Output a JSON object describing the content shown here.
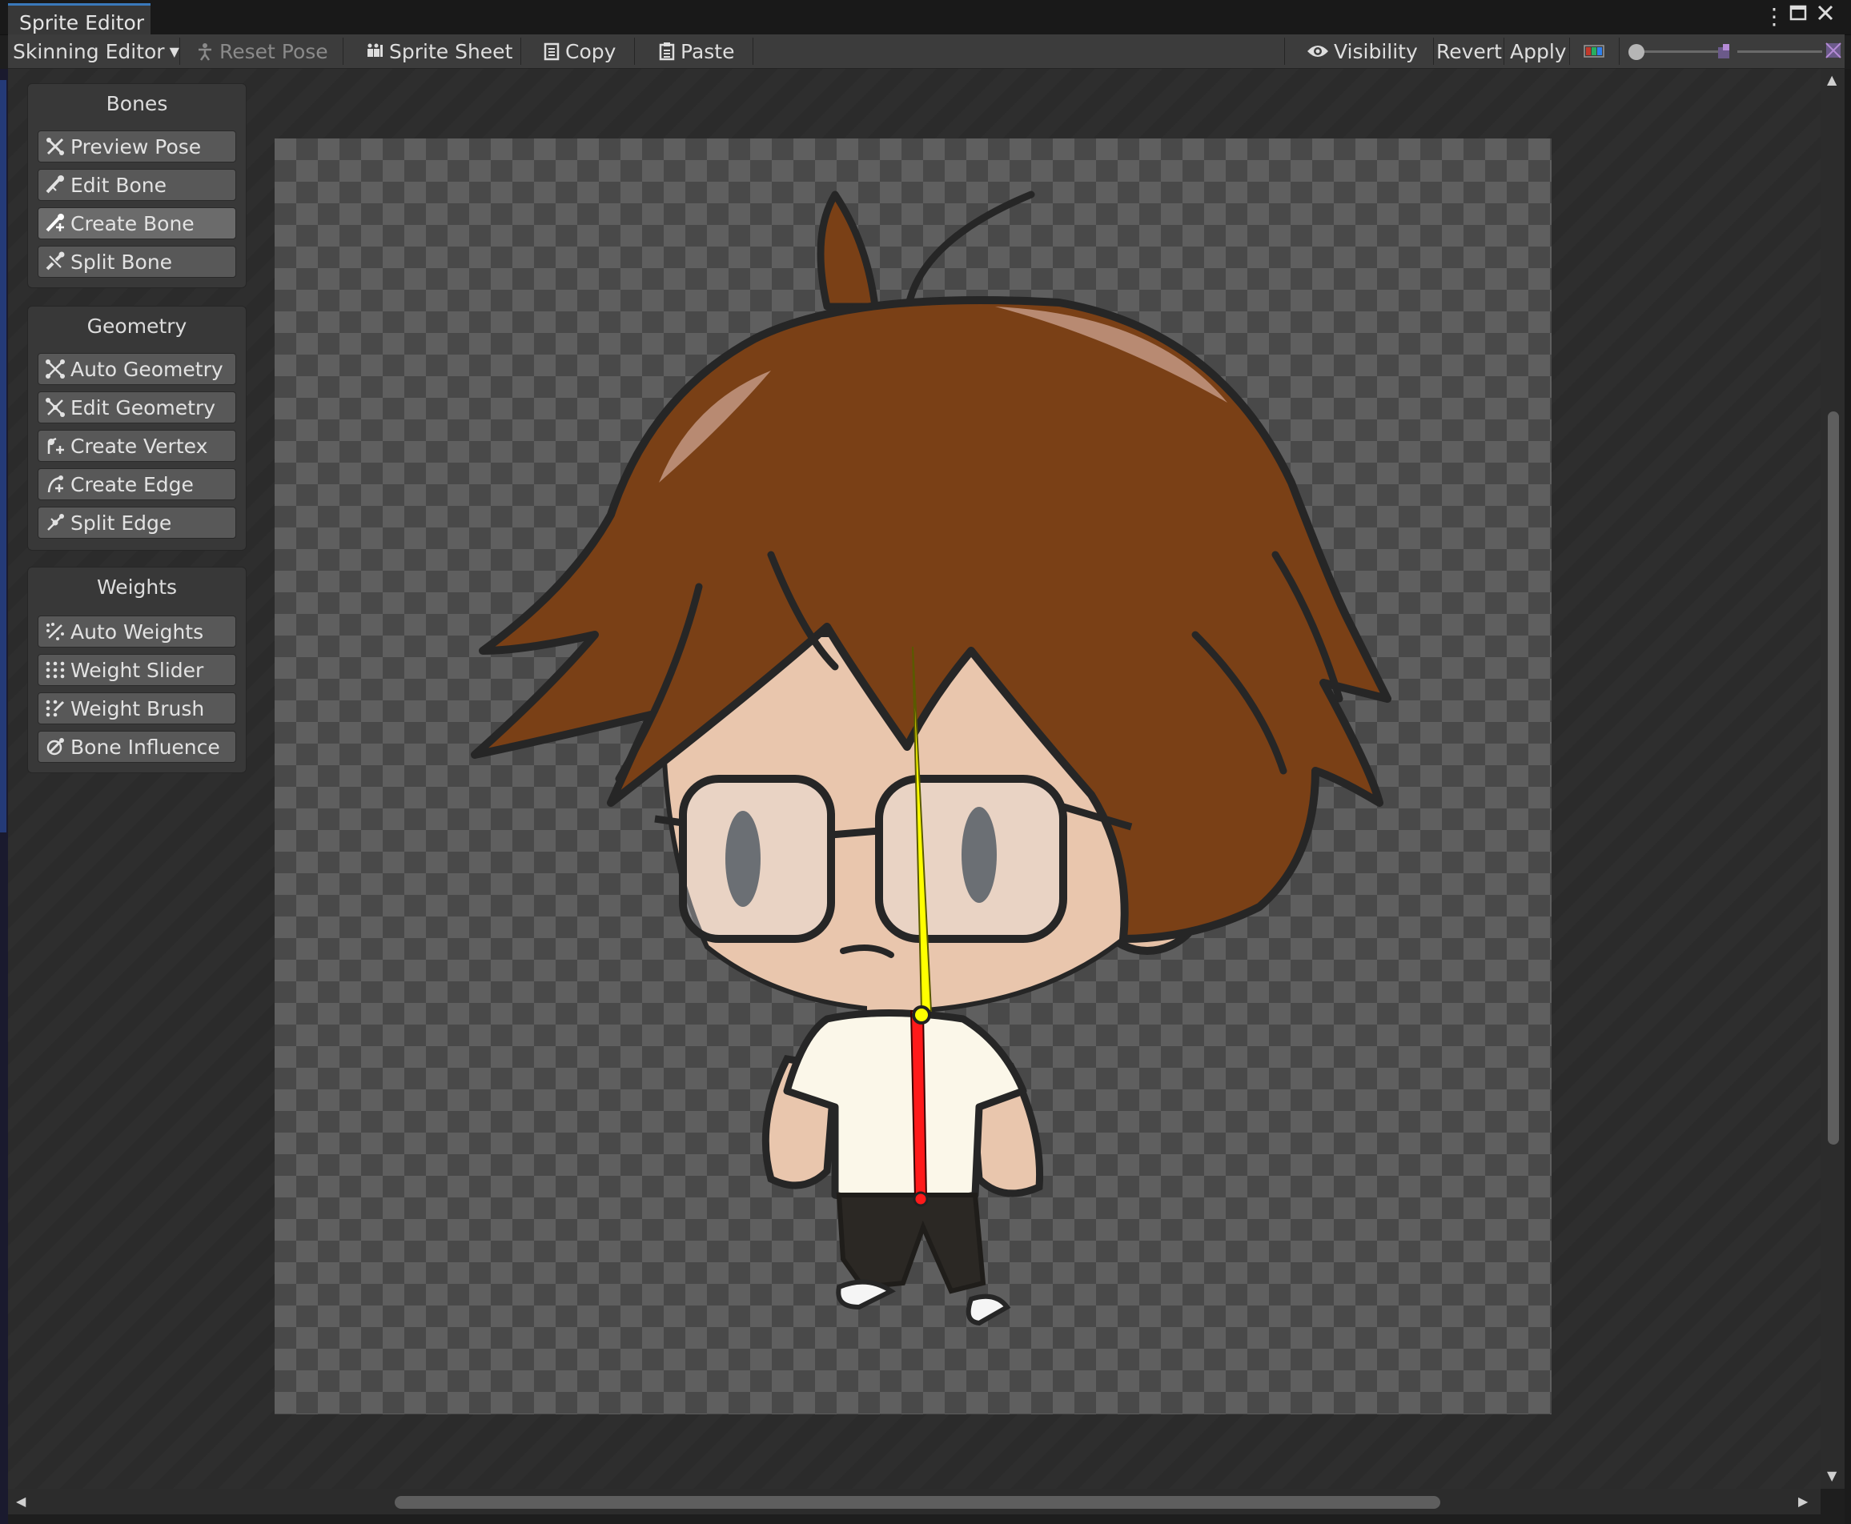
{
  "window": {
    "tab_title": "Sprite Editor",
    "menu_icon": "kebab-menu-icon",
    "maximize_icon": "maximize-icon",
    "close_icon": "close-icon"
  },
  "toolbar": {
    "mode_dropdown": "Skinning Editor",
    "reset_pose": "Reset Pose",
    "sprite_sheet": "Sprite Sheet",
    "copy": "Copy",
    "paste": "Paste",
    "visibility": "Visibility",
    "revert": "Revert",
    "apply": "Apply",
    "color_toggle_icon": "rgb-channel-icon",
    "zoom_slider_value": 0,
    "mip_slider_value": 0
  },
  "panels": {
    "bones": {
      "title": "Bones",
      "tools": [
        {
          "label": "Preview Pose",
          "icon": "preview-pose-icon"
        },
        {
          "label": "Edit Bone",
          "icon": "edit-bone-icon"
        },
        {
          "label": "Create Bone",
          "icon": "create-bone-icon",
          "active": true
        },
        {
          "label": "Split Bone",
          "icon": "split-bone-icon"
        }
      ]
    },
    "geometry": {
      "title": "Geometry",
      "tools": [
        {
          "label": "Auto Geometry",
          "icon": "auto-geometry-icon"
        },
        {
          "label": "Edit Geometry",
          "icon": "edit-geometry-icon"
        },
        {
          "label": "Create Vertex",
          "icon": "create-vertex-icon"
        },
        {
          "label": "Create Edge",
          "icon": "create-edge-icon"
        },
        {
          "label": "Split Edge",
          "icon": "split-edge-icon"
        }
      ]
    },
    "weights": {
      "title": "Weights",
      "tools": [
        {
          "label": "Auto Weights",
          "icon": "auto-weights-icon"
        },
        {
          "label": "Weight Slider",
          "icon": "weight-slider-icon"
        },
        {
          "label": "Weight Brush",
          "icon": "weight-brush-icon"
        },
        {
          "label": "Bone Influence",
          "icon": "bone-influence-icon"
        }
      ]
    }
  },
  "colors": {
    "accent_tab": "#3a79bb",
    "bone_selected": "#ffff00",
    "bone_unselected": "#ff1a1a",
    "hair": "#7a4016",
    "skin": "#e9c6ad",
    "shirt": "#fbf7e9"
  }
}
